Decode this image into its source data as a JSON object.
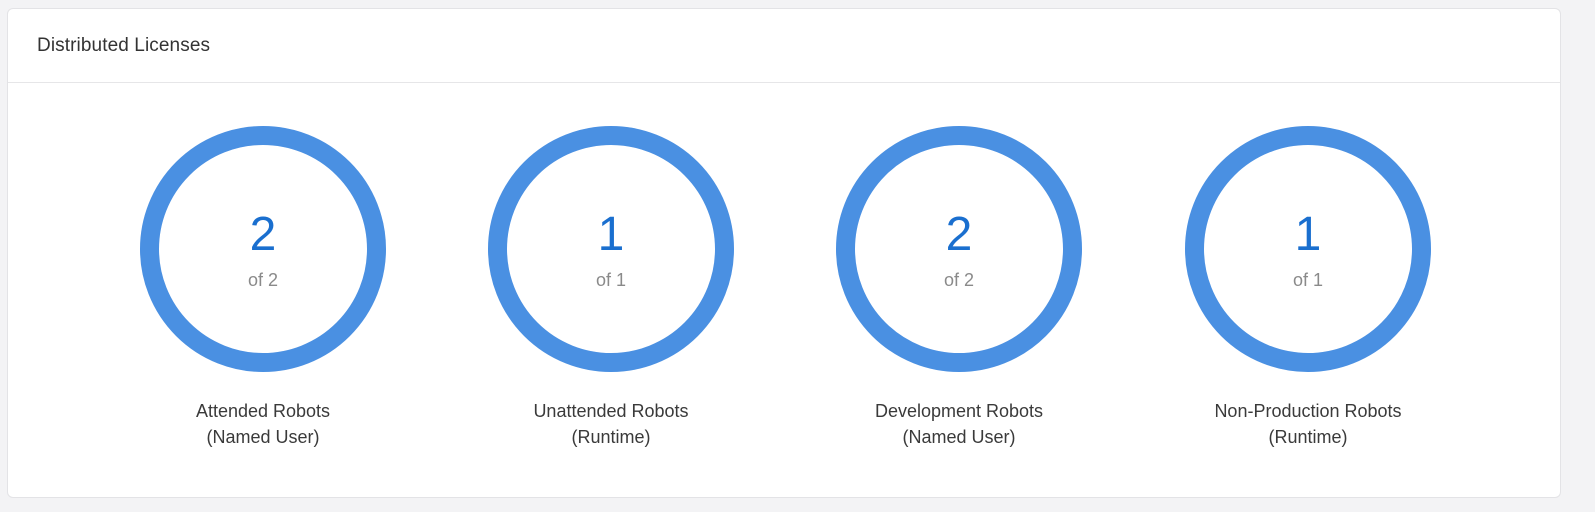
{
  "panel": {
    "title": "Distributed Licenses"
  },
  "gauges": [
    {
      "count": "2",
      "total": "of 2",
      "label_line1": "Attended Robots",
      "label_line2": "(Named User)",
      "fraction": 1.0
    },
    {
      "count": "1",
      "total": "of 1",
      "label_line1": "Unattended Robots",
      "label_line2": "(Runtime)",
      "fraction": 1.0
    },
    {
      "count": "2",
      "total": "of 2",
      "label_line1": "Development Robots",
      "label_line2": "(Named User)",
      "fraction": 1.0
    },
    {
      "count": "1",
      "total": "of 1",
      "label_line1": "Non-Production Robots",
      "label_line2": "(Runtime)",
      "fraction": 1.0
    }
  ],
  "colors": {
    "ring": "#4a90e2",
    "ring_track": "#e8eef7",
    "count": "#1a6fcf"
  }
}
